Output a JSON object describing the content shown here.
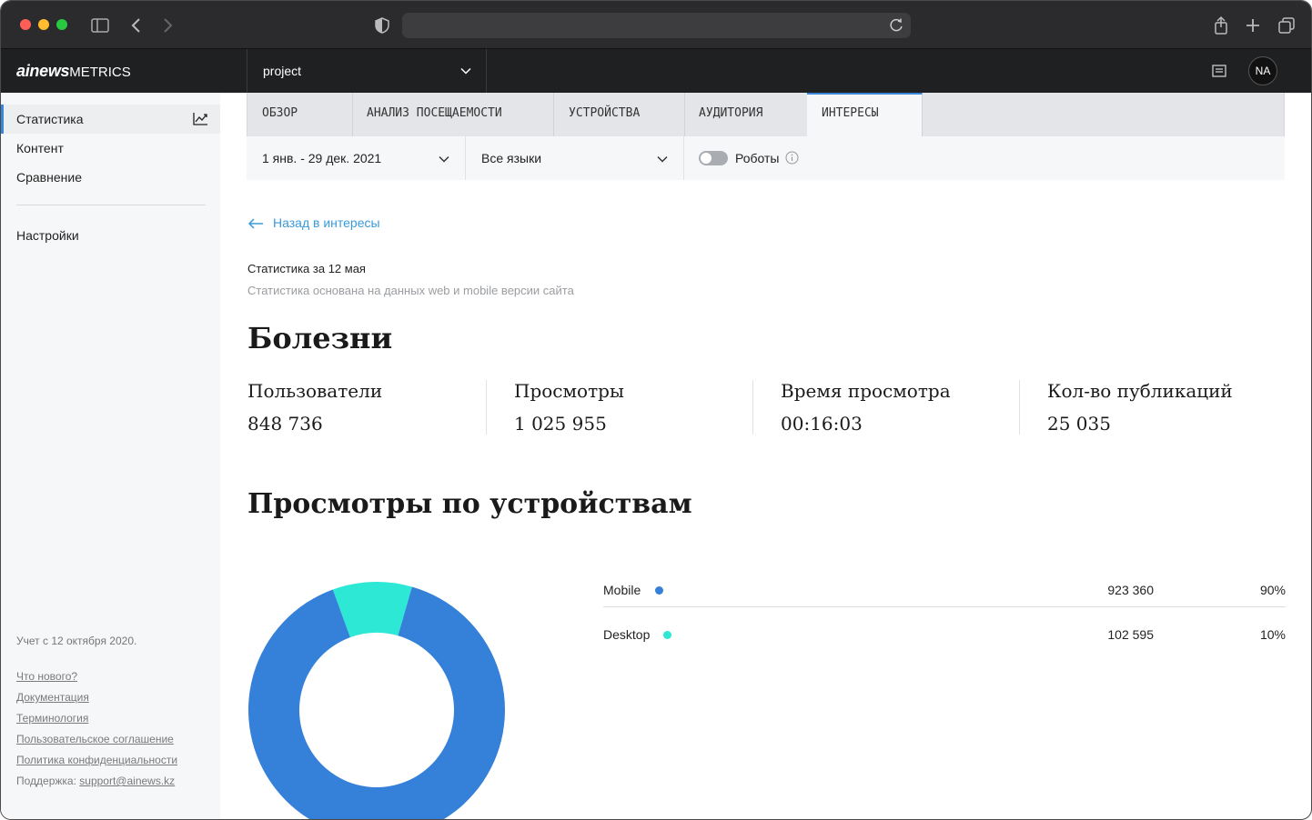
{
  "app": {
    "logo_bold": "ainews",
    "logo_rest": "METRICS",
    "project": "project",
    "avatar": "NA"
  },
  "sidebar": {
    "items": [
      {
        "label": "Статистика"
      },
      {
        "label": "Контент"
      },
      {
        "label": "Сравнение"
      },
      {
        "label": "Настройки"
      }
    ],
    "since": "Учет с 12 октября 2020.",
    "links": [
      {
        "label": "Что нового?"
      },
      {
        "label": "Документация"
      },
      {
        "label": "Терминология"
      },
      {
        "label": "Пользовательское соглашение"
      },
      {
        "label": "Политика конфиденциальности"
      }
    ],
    "support_label": "Поддержка:",
    "support_email": "support@ainews.kz"
  },
  "tabs": [
    {
      "label": "ОБЗОР"
    },
    {
      "label": "АНАЛИЗ ПОСЕЩАЕМОСТИ"
    },
    {
      "label": "УСТРОЙСТВА"
    },
    {
      "label": "АУДИТОРИЯ"
    },
    {
      "label": "ИНТЕРЕСЫ"
    }
  ],
  "filters": {
    "date_range": "1 янв. - 29 дек. 2021",
    "language": "Все языки",
    "robots_label": "Роботы",
    "robots_enabled": false
  },
  "content": {
    "back_link": "Назад в интересы",
    "stat_date": "Статистика за 12 мая",
    "stat_note": "Статистика основана на данных web и mobile версии сайта",
    "title": "Болезни",
    "metrics": [
      {
        "label": "Пользователи",
        "value": "848 736"
      },
      {
        "label": "Просмотры",
        "value": "1 025 955"
      },
      {
        "label": "Время просмотра",
        "value": "00:16:03"
      },
      {
        "label": "Кол-во публикаций",
        "value": "25 035"
      }
    ],
    "devices_title": "Просмотры по устройствам"
  },
  "chart_data": {
    "type": "pie",
    "categories": [
      "Mobile",
      "Desktop"
    ],
    "values": [
      923360,
      102595
    ],
    "display_values": [
      "923 360",
      "102 595"
    ],
    "percents": [
      "90%",
      "10%"
    ],
    "colors": [
      "#3580d8",
      "#2de8d4"
    ]
  }
}
